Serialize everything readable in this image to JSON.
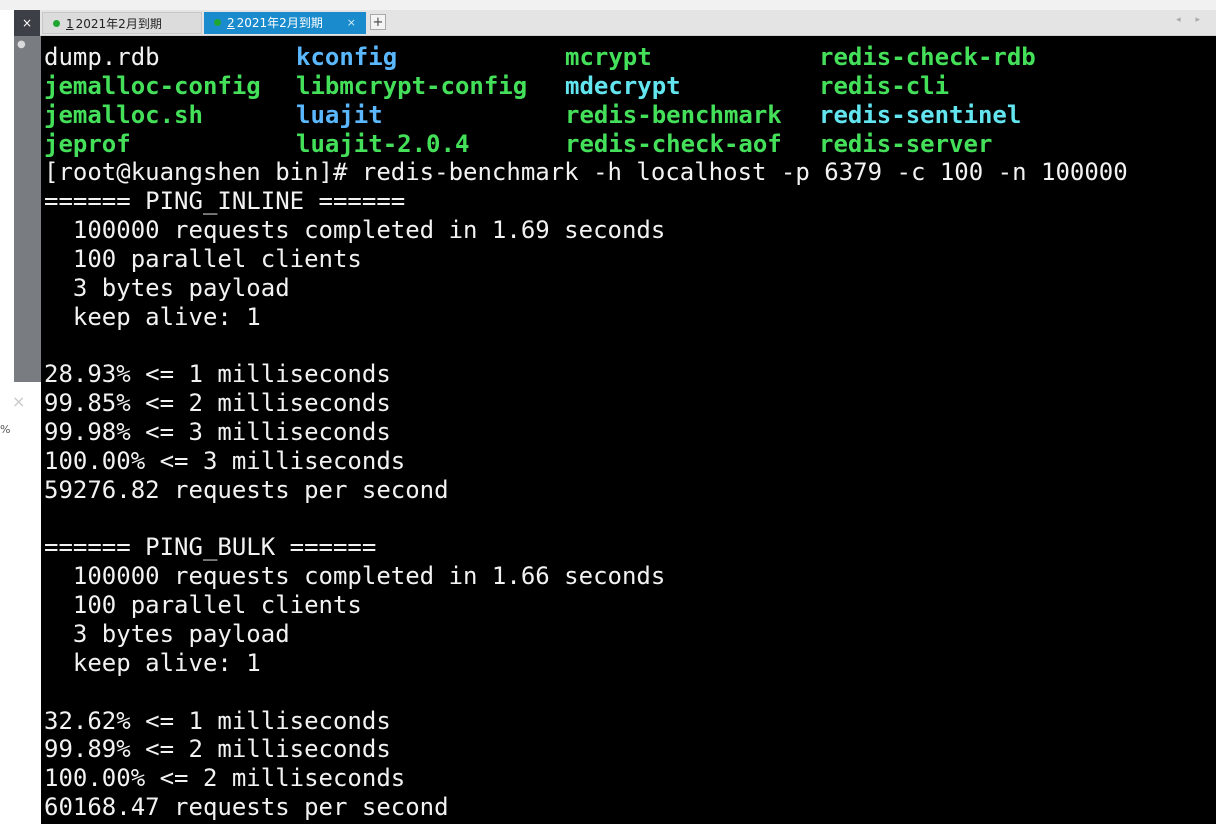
{
  "tabs": [
    {
      "number": "1",
      "label": "2021年2月到期",
      "active": false
    },
    {
      "number": "2",
      "label": "2021年2月到期",
      "active": true
    }
  ],
  "tabbar": {
    "close_all": "×",
    "tab_close": "×",
    "add": "+",
    "scroll": "◂ ▸"
  },
  "side": {
    "close": "×",
    "percent": "%"
  },
  "listing": [
    [
      "dump.rdb",
      "kconfig",
      "mcrypt",
      "redis-check-rdb"
    ],
    [
      "jemalloc-config",
      "libmcrypt-config",
      "mdecrypt",
      "redis-cli"
    ],
    [
      "jemalloc.sh",
      "luajit",
      "redis-benchmark",
      "redis-sentinel"
    ],
    [
      "jeprof",
      "luajit-2.0.4",
      "redis-check-aof",
      "redis-server"
    ]
  ],
  "colors": {
    "exec": "#44e05a",
    "link": "#5bb8ff",
    "sentinel": "#63e5f0",
    "text": "#f2f2f2",
    "terminal_bg": "#000000",
    "tab_active": "#1a8ccd"
  },
  "terminal": {
    "command_line": "[root@kuangshen bin]# redis-benchmark -h localhost -p 6379 -c 100 -n 100000",
    "output": [
      "====== PING_INLINE ======",
      "  100000 requests completed in 1.69 seconds",
      "  100 parallel clients",
      "  3 bytes payload",
      "  keep alive: 1",
      "",
      "28.93% <= 1 milliseconds",
      "99.85% <= 2 milliseconds",
      "99.98% <= 3 milliseconds",
      "100.00% <= 3 milliseconds",
      "59276.82 requests per second",
      "",
      "====== PING_BULK ======",
      "  100000 requests completed in 1.66 seconds",
      "  100 parallel clients",
      "  3 bytes payload",
      "  keep alive: 1",
      "",
      "32.62% <= 1 milliseconds",
      "99.89% <= 2 milliseconds",
      "100.00% <= 2 milliseconds",
      "60168.47 requests per second"
    ]
  }
}
